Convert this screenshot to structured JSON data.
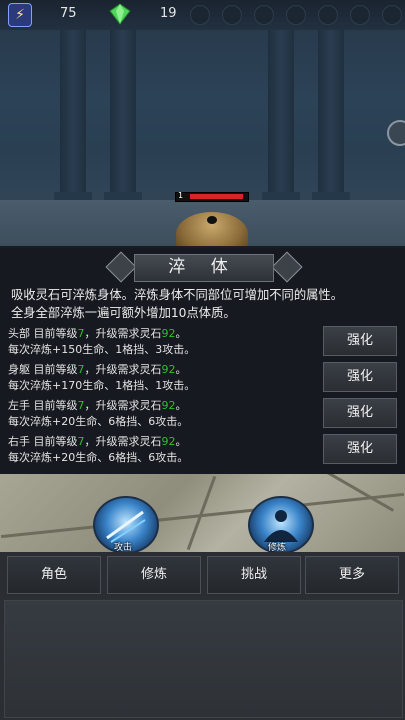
{
  "resources": {
    "energy": "75",
    "gems": "19"
  },
  "enemy": {
    "level": "1",
    "hp_fraction": 0.95
  },
  "panel": {
    "title": "淬 体",
    "desc_line1": "吸收灵石可淬炼身体。淬炼身体不同部位可增加不同的属性。",
    "desc_line2": "全身全部淬炼一遍可额外增加10点体质。",
    "rows": [
      {
        "part": "头部",
        "pre": "目前等级",
        "level": "7",
        "mid": "，升级需求灵石",
        "cost": "92",
        "end": "。",
        "effect": "每次淬炼+150生命、1格挡、3攻击。",
        "button": "强化"
      },
      {
        "part": "身躯",
        "pre": "目前等级",
        "level": "7",
        "mid": "，升级需求灵石",
        "cost": "92",
        "end": "。",
        "effect": "每次淬炼+170生命、1格挡、1攻击。",
        "button": "强化"
      },
      {
        "part": "左手",
        "pre": "目前等级",
        "level": "7",
        "mid": "，升级需求灵石",
        "cost": "92",
        "end": "。",
        "effect": "每次淬炼+20生命、6格挡、6攻击。",
        "button": "强化"
      },
      {
        "part": "右手",
        "pre": "目前等级",
        "level": "7",
        "mid": "，升级需求灵石",
        "cost": "92",
        "end": "。",
        "effect": "每次淬炼+20生命、6格挡、6攻击。",
        "button": "强化"
      }
    ]
  },
  "skills": {
    "attack": "攻击",
    "cultivate": "修炼"
  },
  "nav": [
    "角色",
    "修炼",
    "挑战",
    "更多"
  ],
  "colors": {
    "highlight": "#27c22a",
    "hp": "#d8232a"
  },
  "icons": {
    "energy": "lightning-icon",
    "gem": "gem-icon"
  }
}
